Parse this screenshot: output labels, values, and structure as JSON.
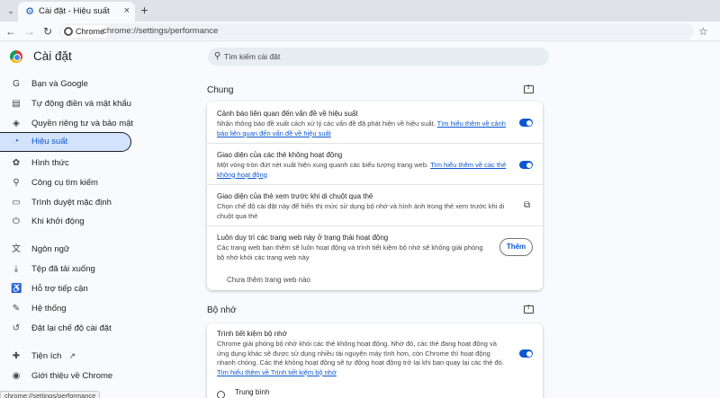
{
  "browser": {
    "tab_title": "Cài đặt - Hiệu suất",
    "tab_icon": "gear-icon",
    "new_tab_symbol": "+",
    "omnibox_chip": "Chrome",
    "url": "chrome://settings/performance",
    "status_url": "chrome://settings/performance"
  },
  "sidebar": {
    "title": "Cài đặt",
    "items": [
      {
        "label": "Bạn và Google",
        "icon": "google-icon",
        "glyph": "G"
      },
      {
        "label": "Tự động điền và mật khẩu",
        "icon": "clipboard-icon",
        "glyph": "▤"
      },
      {
        "label": "Quyền riêng tư và bảo mật",
        "icon": "shield-icon",
        "glyph": "◈"
      },
      {
        "label": "Hiệu suất",
        "icon": "speedometer-icon",
        "glyph": "◔"
      },
      {
        "label": "Hình thức",
        "icon": "palette-icon",
        "glyph": "✿"
      },
      {
        "label": "Công cụ tìm kiếm",
        "icon": "search-icon",
        "glyph": "⚲"
      },
      {
        "label": "Trình duyệt mặc định",
        "icon": "browser-icon",
        "glyph": "▭"
      },
      {
        "label": "Khi khởi động",
        "icon": "power-icon",
        "glyph": "⏻"
      },
      {
        "label": "Ngôn ngữ",
        "icon": "translate-icon",
        "glyph": "文"
      },
      {
        "label": "Tệp đã tải xuống",
        "icon": "download-icon",
        "glyph": "⤓"
      },
      {
        "label": "Hỗ trợ tiếp cận",
        "icon": "accessibility-icon",
        "glyph": "♿"
      },
      {
        "label": "Hệ thống",
        "icon": "wrench-icon",
        "glyph": "✎"
      },
      {
        "label": "Đặt lại chế độ cài đặt",
        "icon": "reset-icon",
        "glyph": "↺"
      },
      {
        "label": "Tiện ích",
        "icon": "puzzle-icon",
        "glyph": "✚"
      },
      {
        "label": "Giới thiệu về Chrome",
        "icon": "chrome-icon",
        "glyph": "◉"
      }
    ],
    "active_index": 3
  },
  "search": {
    "placeholder": "Tìm kiếm cài đặt"
  },
  "general": {
    "heading": "Chung",
    "alerts": {
      "title": "Cảnh báo liên quan đến vấn đề về hiệu suất",
      "desc": "Nhận thông báo đề xuất cách xử lý các vấn đề đã phát hiện về hiệu suất.",
      "link": "Tìm hiểu thêm về cảnh báo liên quan đến vấn đề về hiệu suất",
      "enabled": true
    },
    "inactive_ui": {
      "title": "Giao diện của các thẻ không hoạt động",
      "desc": "Một vòng tròn đứt nét xuất hiện xung quanh các biểu tượng trang web.",
      "link": "Tìm hiểu thêm về các thẻ không hoạt động",
      "enabled": true
    },
    "hover_preview": {
      "title": "Giao diện của thẻ xem trước khi di chuột qua thẻ",
      "desc": "Chọn chế độ cài đặt này để hiển thị mức sử dụng bộ nhớ và hình ảnh trong thẻ xem trước khi di chuột qua thẻ"
    },
    "keep_active": {
      "title": "Luôn duy trì các trang web này ở trạng thái hoạt động",
      "desc": "Các trang web bạn thêm sẽ luôn hoạt động và trình tiết kiệm bộ nhớ sẽ không giải phóng bộ nhớ khỏi các trang web này",
      "add_button": "Thêm",
      "empty": "Chưa thêm trang web nào"
    }
  },
  "memory": {
    "heading": "Bộ nhớ",
    "saver": {
      "title": "Trình tiết kiệm bộ nhớ",
      "desc": "Chrome giải phóng bộ nhớ khỏi các thẻ không hoạt động. Nhờ đó, các thẻ đang hoạt động và ứng dụng khác sẽ được sử dụng nhiều tài nguyên máy tính hơn, còn Chrome thì hoạt động nhanh chóng. Các thẻ không hoạt động sẽ tự động hoạt động trở lại khi bạn quay lại các thẻ đó.",
      "link": "Tìm hiểu thêm về Trình tiết kiệm bộ nhớ",
      "enabled": true
    },
    "option_label": "Trung bình"
  },
  "colors": {
    "accent": "#0b57d0",
    "active_nav_bg": "#d3e3fd"
  }
}
